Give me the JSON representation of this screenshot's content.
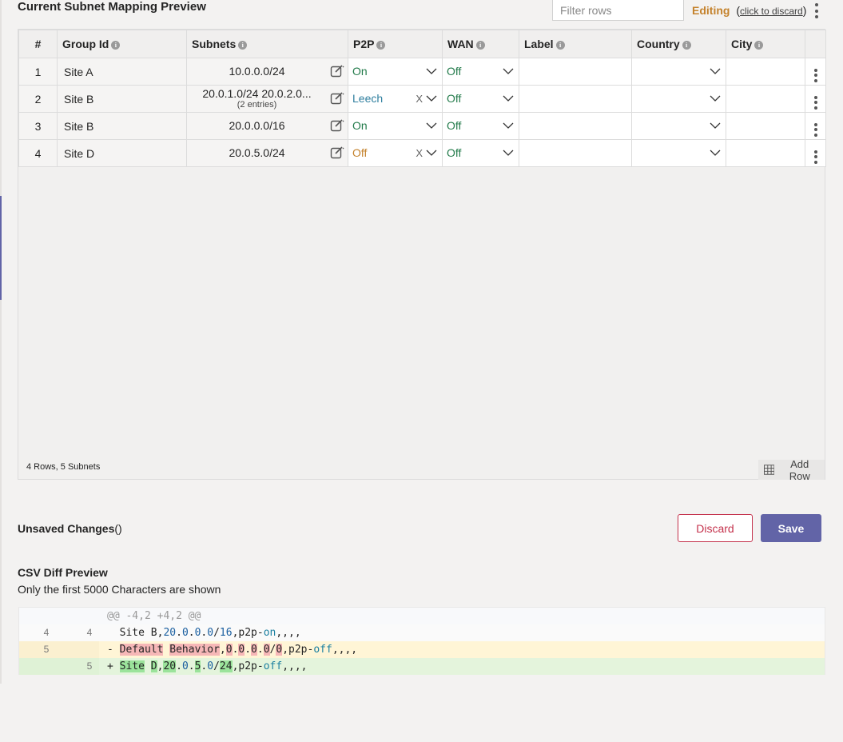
{
  "header": {
    "title": "Current Subnet Mapping Preview",
    "filter_placeholder": "Filter rows",
    "editing_label": "Editing",
    "discard_link": "click to discard",
    "paren_open": "(",
    "paren_close": ")"
  },
  "grid": {
    "columns": [
      "#",
      "Group Id",
      "Subnets",
      "P2P",
      "WAN",
      "Label",
      "Country",
      "City"
    ],
    "rows": [
      {
        "num": "1",
        "group": "Site A",
        "subnet": "10.0.0.0/24",
        "subnet_sub": "",
        "p2p": "On",
        "p2p_clear": "",
        "wan": "Off",
        "label": "",
        "country": "",
        "city": ""
      },
      {
        "num": "2",
        "group": "Site B",
        "subnet": "20.0.1.0/24 20.0.2.0...",
        "subnet_sub": "(2 entries)",
        "p2p": "Leech",
        "p2p_clear": "X",
        "wan": "Off",
        "label": "",
        "country": "",
        "city": ""
      },
      {
        "num": "3",
        "group": "Site B",
        "subnet": "20.0.0.0/16",
        "subnet_sub": "",
        "p2p": "On",
        "p2p_clear": "",
        "wan": "Off",
        "label": "",
        "country": "",
        "city": ""
      },
      {
        "num": "4",
        "group": "Site D",
        "subnet": "20.0.5.0/24",
        "subnet_sub": "",
        "p2p": "Off",
        "p2p_clear": "X",
        "wan": "Off",
        "label": "",
        "country": "",
        "city": ""
      }
    ],
    "footer_count": "4 Rows, 5 Subnets",
    "add_row_label": "Add Row"
  },
  "changes": {
    "title": "Unsaved Changes",
    "title_suffix": "()",
    "discard_label": "Discard",
    "save_label": "Save"
  },
  "csv": {
    "title": "CSV Diff Preview",
    "subtitle": "Only the first 5000 Characters are shown",
    "hunk": "@@ -4,2 +4,2 @@",
    "ctx_old_ln": "4",
    "ctx_new_ln": "4",
    "del_ln": "5",
    "add_ln": "5",
    "ctx_line": "Site B,20.0.0.0/16,p2p-on,,,,",
    "del_line": "- Default Behavior,0.0.0.0/0,p2p-off,,,,",
    "add_line": "+ Site D,20.0.5.0/24,p2p-off,,,,"
  },
  "colors": {
    "accent": "#6264a7",
    "editing": "#c4822c",
    "discard": "#c4314b",
    "on_green": "#237b4b",
    "leech_teal": "#2f7f9f"
  }
}
